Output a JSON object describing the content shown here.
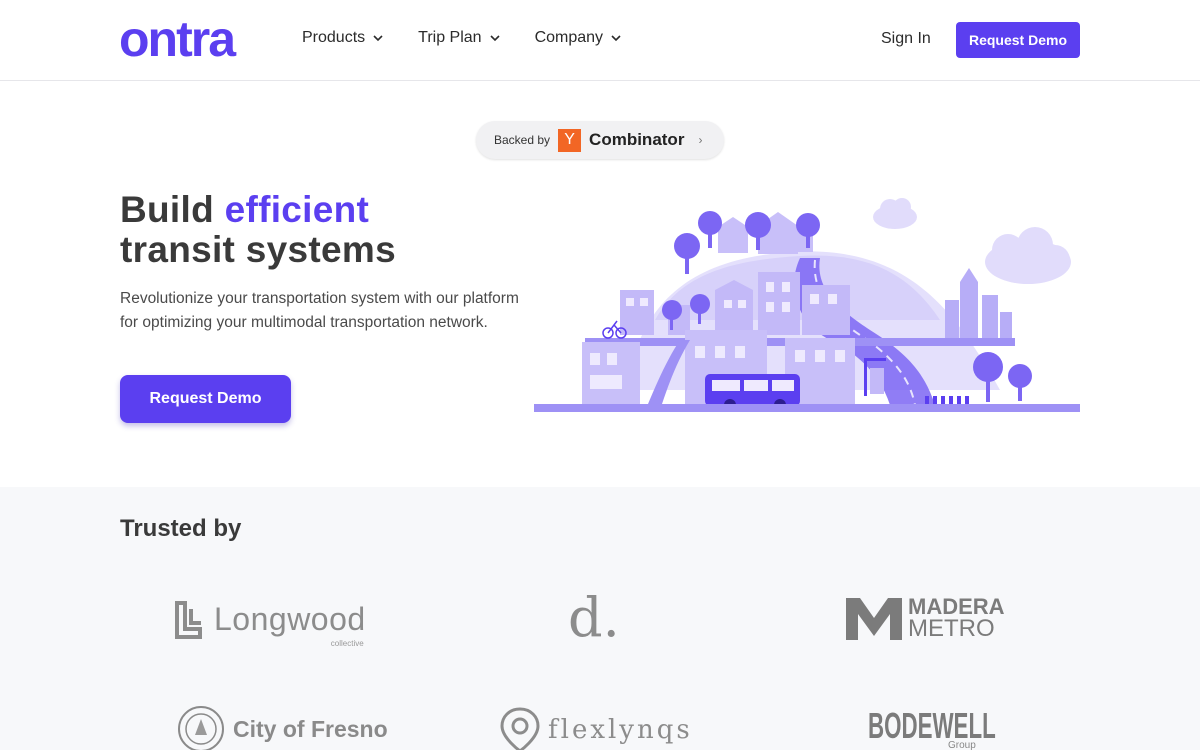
{
  "header": {
    "logo_text": "ontra",
    "nav": [
      {
        "label": "Products"
      },
      {
        "label": "Trip Plan"
      },
      {
        "label": "Company"
      }
    ],
    "sign_in": "Sign In",
    "request_demo": "Request Demo"
  },
  "badge": {
    "backed_by": "Backed by",
    "yc_letter": "Y",
    "yc_name": "Combinator",
    "arrow": "›"
  },
  "hero": {
    "title_line1_start": "Build",
    "title_line1_accent": "efficient",
    "title_line2": "transit systems",
    "subtitle": "Revolutionize your transportation system with our platform for optimizing your multimodal transportation network.",
    "cta": "Request Demo"
  },
  "trusted": {
    "title": "Trusted by",
    "logos": [
      {
        "name": "Longwood",
        "sub": "collective"
      },
      {
        "name": "d."
      },
      {
        "name_top": "MADERA",
        "name_bottom": "METRO"
      },
      {
        "name": "City of Fresno"
      },
      {
        "name": "flexlynqs"
      },
      {
        "name": "BODEWELL",
        "sub": "Group"
      }
    ]
  },
  "colors": {
    "brand": "#5b3ff0",
    "text": "#3a3a3a",
    "illustration_light": "#e4e0fc",
    "illustration_mid": "#b7adf7",
    "illustration_dark": "#7c66f3"
  }
}
